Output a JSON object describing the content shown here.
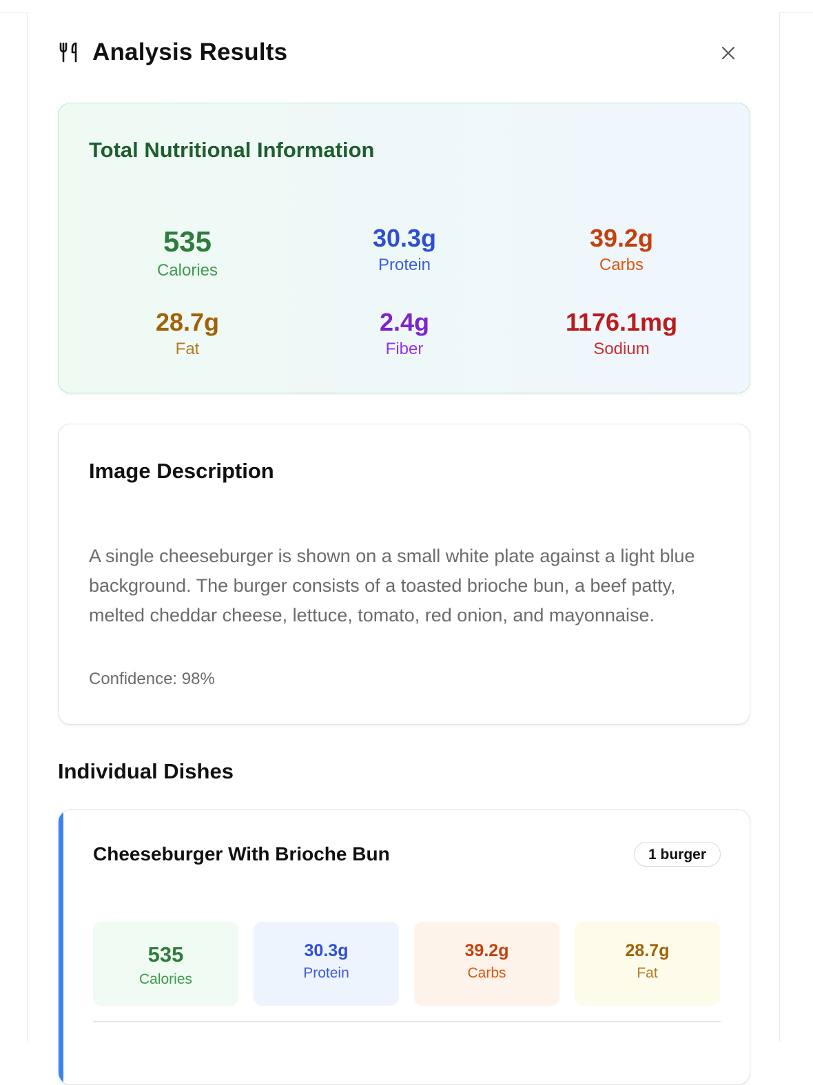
{
  "header": {
    "title": "Analysis Results",
    "icon": "utensils-icon",
    "close_icon": "close-icon"
  },
  "totals": {
    "title": "Total Nutritional Information",
    "calories": {
      "value": "535",
      "label": "Calories",
      "color": "#2e7d3b"
    },
    "protein": {
      "value": "30.3g",
      "label": "Protein",
      "color": "#2f4fd1"
    },
    "carbs": {
      "value": "39.2g",
      "label": "Carbs",
      "color": "#c2410c"
    },
    "fat": {
      "value": "28.7g",
      "label": "Fat",
      "color": "#a16207"
    },
    "fiber": {
      "value": "2.4g",
      "label": "Fiber",
      "color": "#7e22ce"
    },
    "sodium": {
      "value": "1176.1mg",
      "label": "Sodium",
      "color": "#b91c1c"
    }
  },
  "description": {
    "title": "Image Description",
    "text": "A single cheeseburger is shown on a small white plate against a light blue background. The burger consists of a toasted brioche bun, a beef patty, melted cheddar cheese, lettuce, tomato, red onion, and mayonnaise.",
    "confidence": "Confidence: 98%"
  },
  "dishes_section": {
    "title": "Individual Dishes"
  },
  "dishes": [
    {
      "name": "Cheeseburger With Brioche Bun",
      "portion": "1 burger",
      "accent_color": "#3b82f6",
      "calories": {
        "value": "535",
        "label": "Calories"
      },
      "protein": {
        "value": "30.3g",
        "label": "Protein"
      },
      "carbs": {
        "value": "39.2g",
        "label": "Carbs"
      },
      "fat": {
        "value": "28.7g",
        "label": "Fat"
      }
    }
  ]
}
